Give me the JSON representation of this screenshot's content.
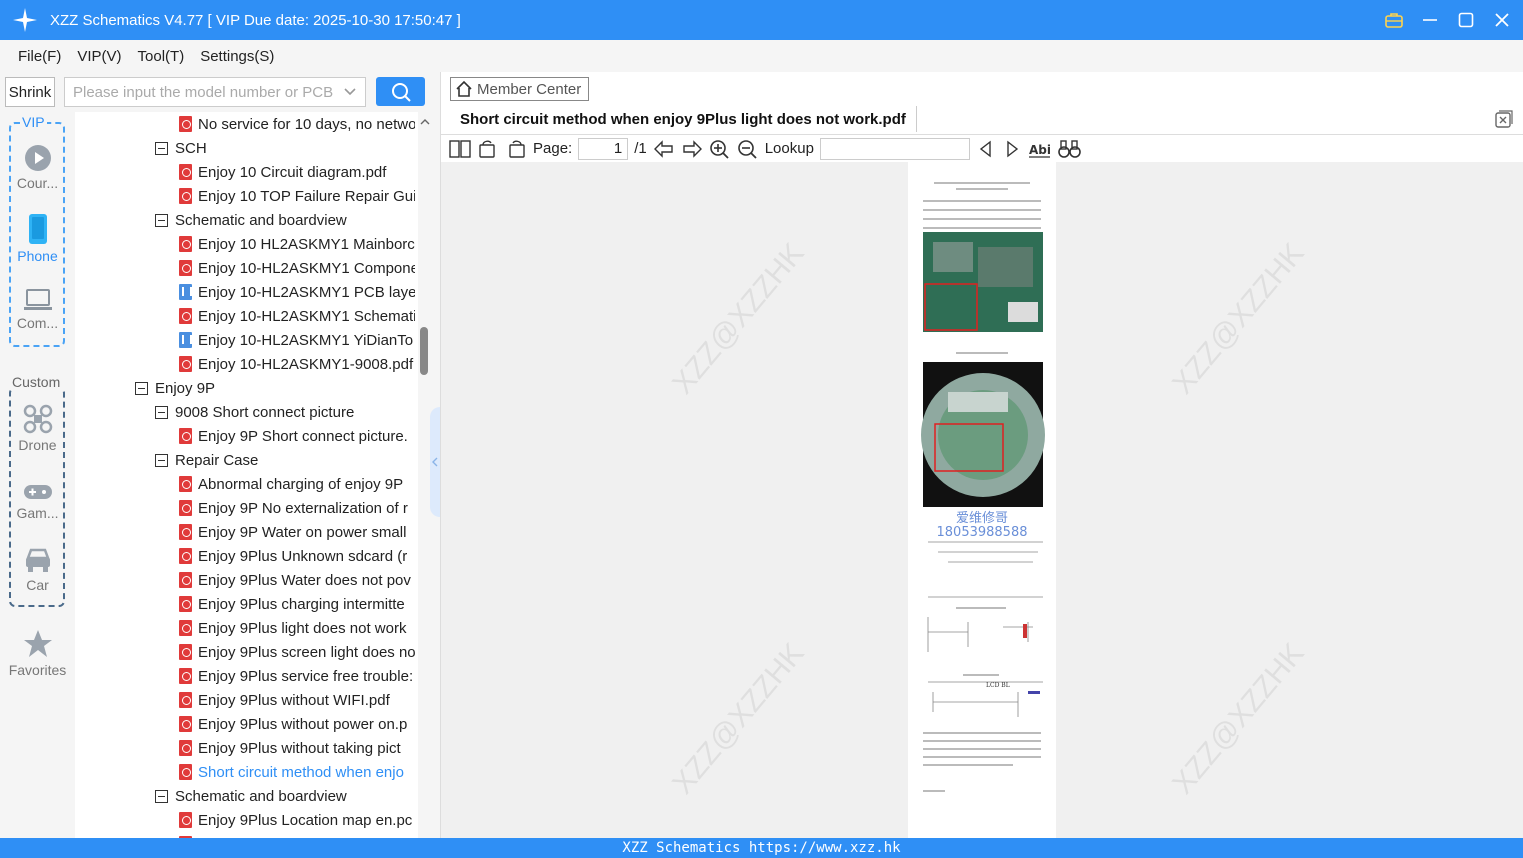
{
  "window": {
    "title": "XZZ Schematics V4.77 [ VIP Due date: 2025-10-30 17:50:47 ]"
  },
  "menu": [
    "File(F)",
    "VIP(V)",
    "Tool(T)",
    "Settings(S)"
  ],
  "search": {
    "shrink_label": "Shrink",
    "placeholder": "Please input the model number or PCB"
  },
  "categories": {
    "vip_label": "VIP",
    "custom_label": "Custom",
    "items": [
      {
        "label": "Cour..."
      },
      {
        "label": "Phone"
      },
      {
        "label": "Com..."
      },
      {
        "label": "Drone"
      },
      {
        "label": "Gam..."
      },
      {
        "label": "Car"
      },
      {
        "label": "Favorites"
      }
    ]
  },
  "tree": [
    {
      "label": "No service for 10 days, no netwo"
    },
    {
      "label": "SCH"
    },
    {
      "label": "Enjoy 10 Circuit diagram.pdf"
    },
    {
      "label": "Enjoy 10 TOP Failure Repair Gui"
    },
    {
      "label": "Schematic and boardview"
    },
    {
      "label": "Enjoy 10 HL2ASKMY1 Mainborc"
    },
    {
      "label": "Enjoy 10-HL2ASKMY1 Compone"
    },
    {
      "label": "Enjoy 10-HL2ASKMY1 PCB layer"
    },
    {
      "label": "Enjoy 10-HL2ASKMY1 Schemati"
    },
    {
      "label": "Enjoy 10-HL2ASKMY1 YiDianTo"
    },
    {
      "label": "Enjoy 10-HL2ASKMY1-9008.pdf"
    },
    {
      "label": "Enjoy 9P"
    },
    {
      "label": "9008 Short connect picture"
    },
    {
      "label": "Enjoy 9P Short connect picture."
    },
    {
      "label": "Repair Case"
    },
    {
      "label": "Abnormal charging of enjoy 9P"
    },
    {
      "label": "Enjoy 9P No externalization of r"
    },
    {
      "label": "Enjoy 9P Water on power small"
    },
    {
      "label": "Enjoy 9Plus Unknown sdcard (r"
    },
    {
      "label": "Enjoy 9Plus Water does not pov"
    },
    {
      "label": "Enjoy 9Plus charging intermitte"
    },
    {
      "label": "Enjoy 9Plus light does not work"
    },
    {
      "label": "Enjoy 9Plus screen light does no"
    },
    {
      "label": "Enjoy 9Plus service free trouble:"
    },
    {
      "label": "Enjoy 9Plus without WIFI.pdf"
    },
    {
      "label": "Enjoy 9Plus without power on.p"
    },
    {
      "label": "Enjoy 9Plus without taking pict"
    },
    {
      "label": "Short circuit method when enjo"
    },
    {
      "label": "Schematic and boardview"
    },
    {
      "label": "Enjoy 9Plus Location map en.pc"
    }
  ],
  "viewer": {
    "member_center": "Member Center",
    "doc_tab": "Short circuit method when enjoy 9Plus light does not work.pdf",
    "page_label": "Page:",
    "page_current": "1",
    "page_total": "/1",
    "lookup_label": "Lookup",
    "watermark": "XZZ@XZZHK",
    "page_contact_text": "爱维修哥",
    "page_phone": "18053988588"
  },
  "statusbar": {
    "text": "XZZ Schematics https://www.xzz.hk"
  },
  "colors": {
    "accent": "#2f8ff5",
    "pdf_icon": "#e03a3a",
    "pcb_icon": "#4a8fe0"
  }
}
